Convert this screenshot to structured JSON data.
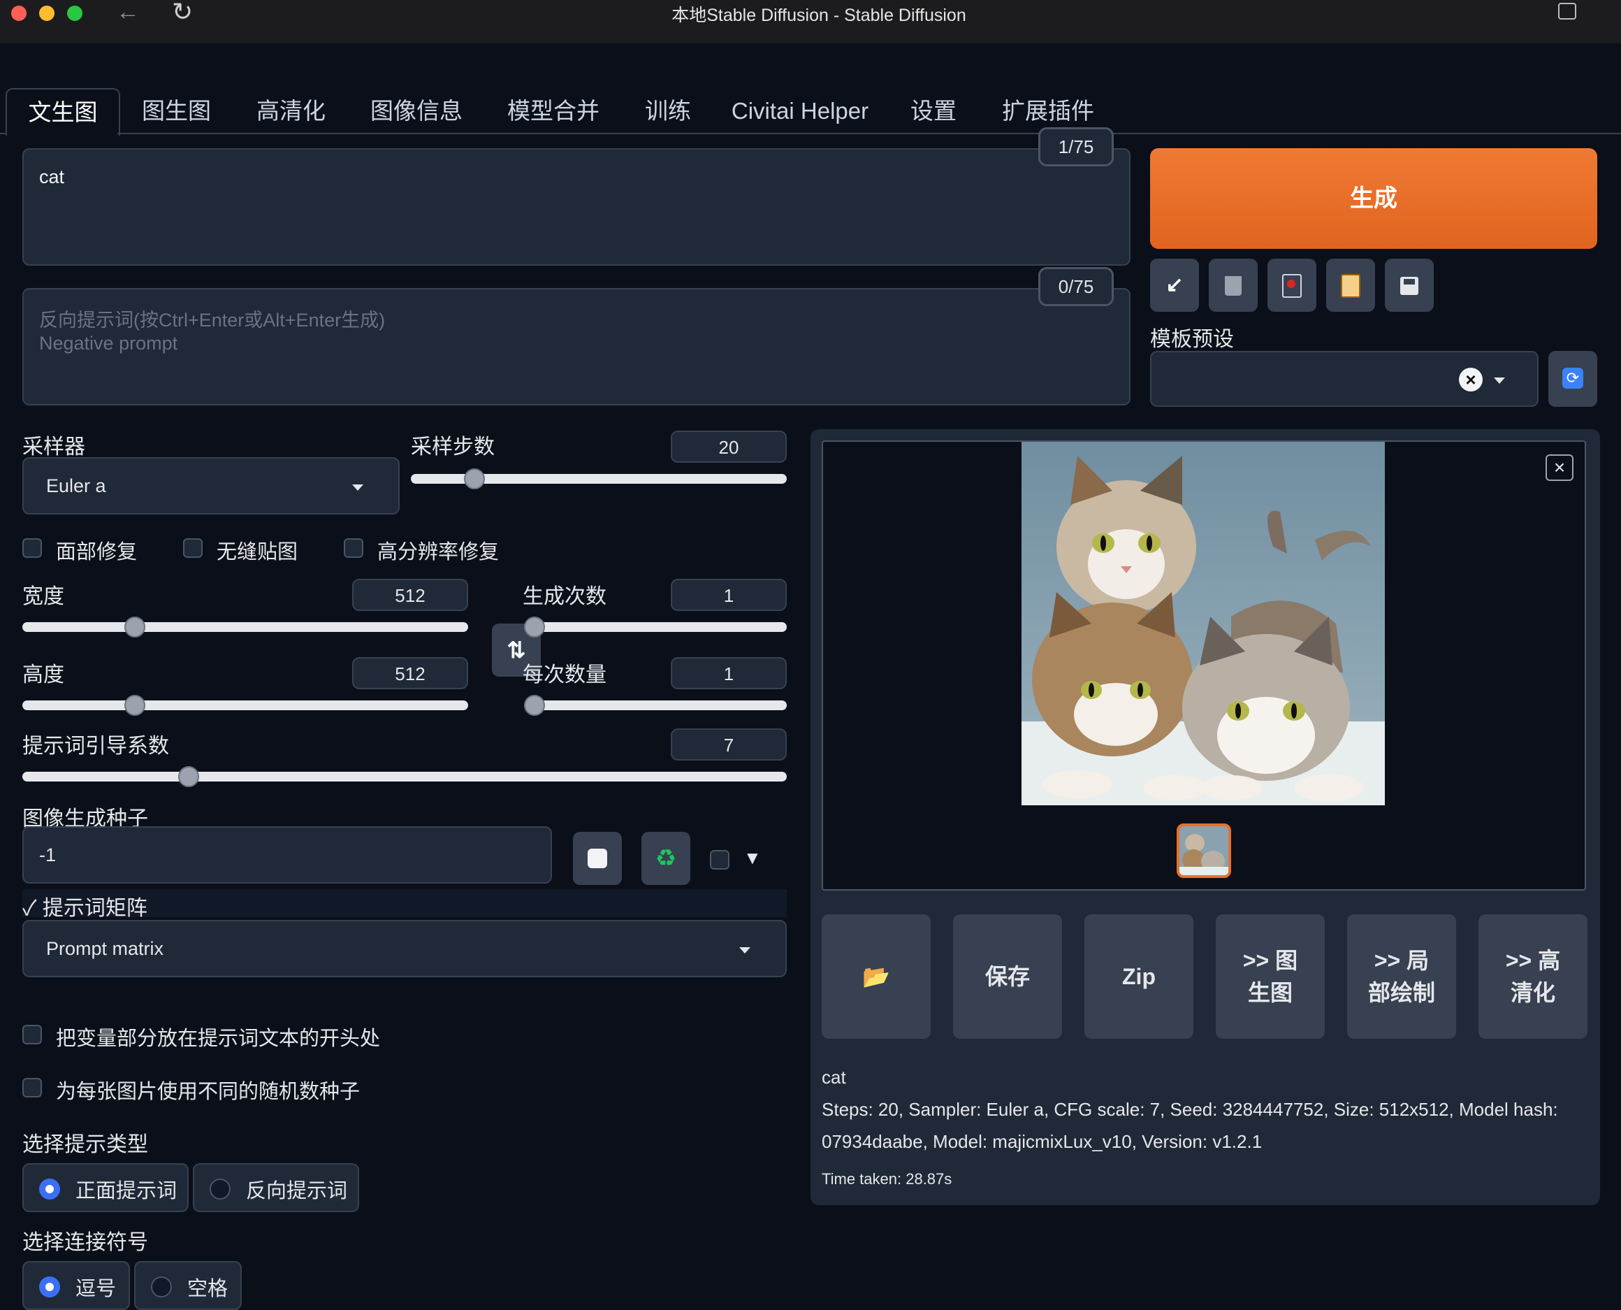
{
  "window": {
    "title": "本地Stable Diffusion - Stable Diffusion"
  },
  "tabs": [
    "文生图",
    "图生图",
    "高清化",
    "图像信息",
    "模型合并",
    "训练",
    "Civitai Helper",
    "设置",
    "扩展插件"
  ],
  "prompt": {
    "value": "cat",
    "counter": "1/75"
  },
  "negative_prompt": {
    "placeholder_line1": "反向提示词(按Ctrl+Enter或Alt+Enter生成)",
    "placeholder_line2": "Negative prompt",
    "counter": "0/75"
  },
  "generate_label": "生成",
  "tools": [
    "arrow-icon",
    "trash-icon",
    "red-card-icon",
    "clipboard-icon",
    "save-icon"
  ],
  "styles": {
    "label": "模板预设",
    "value": ""
  },
  "sampler": {
    "label": "采样器",
    "value": "Euler a"
  },
  "steps": {
    "label": "采样步数",
    "value": "20",
    "level": 0.15
  },
  "checkboxes": [
    "面部修复",
    "无缝贴图",
    "高分辨率修复"
  ],
  "width": {
    "label": "宽度",
    "value": "512",
    "level": 0.24
  },
  "height": {
    "label": "高度",
    "value": "512",
    "level": 0.24
  },
  "batch_count": {
    "label": "生成次数",
    "value": "1",
    "level": 0.0
  },
  "batch_size": {
    "label": "每次数量",
    "value": "1",
    "level": 0.0
  },
  "cfg": {
    "label": "提示词引导系数",
    "value": "7",
    "level": 0.21
  },
  "seed": {
    "label": "图像生成种子",
    "value": "-1"
  },
  "script": {
    "header": "✓ 提示词矩阵",
    "value": "Prompt matrix"
  },
  "matrix_options": [
    "把变量部分放在提示词文本的开头处",
    "为每张图片使用不同的随机数种子"
  ],
  "prompt_type": {
    "label": "选择提示类型",
    "options": [
      "正面提示词",
      "反向提示词"
    ],
    "selected": 0
  },
  "joiner": {
    "label": "选择连接符号",
    "options": [
      "逗号",
      "空格"
    ],
    "selected": 0
  },
  "actions": [
    "📂",
    "保存",
    "Zip",
    ">> 图生图",
    ">> 局部绘制",
    ">> 高清化"
  ],
  "info": {
    "prompt": "cat",
    "params_line1": "Steps: 20, Sampler: Euler a, CFG scale: 7, Seed: 3284447752, Size: 512x512, Model hash:",
    "params_line2": "07934daabe, Model: majicmixLux_v10, Version: v1.2.1",
    "time": "Time taken: 28.87s"
  },
  "colors": {
    "accent": "#e8702a",
    "bg": "#0b0f19",
    "panel": "#1f2937"
  }
}
